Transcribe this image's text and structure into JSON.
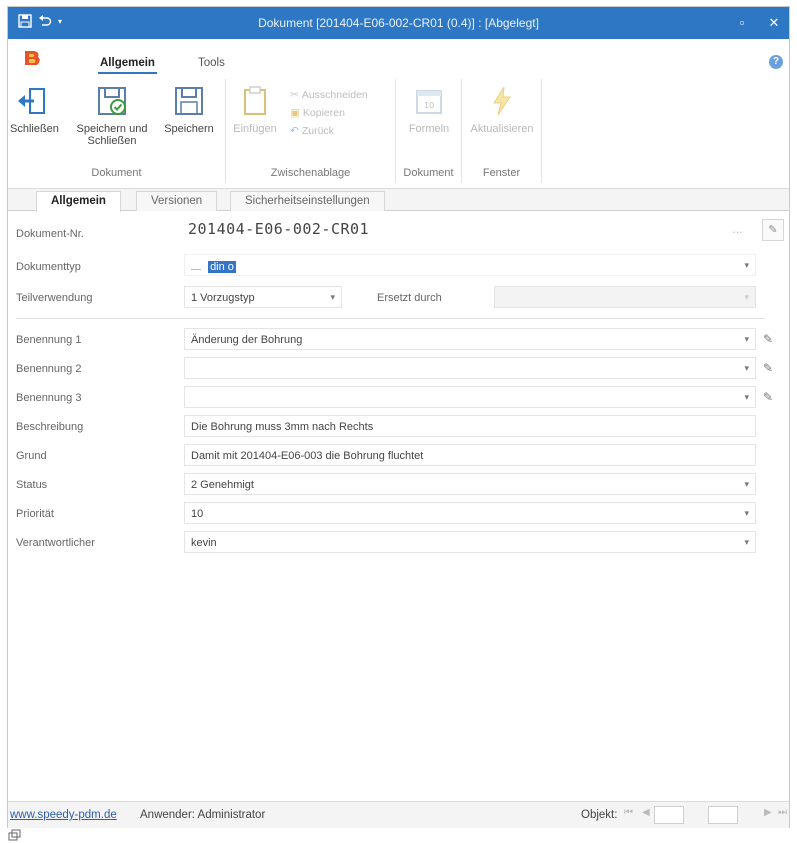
{
  "window": {
    "title": "Dokument [201404-E06-002-CR01 (0.4)] : [Abgelegt]"
  },
  "ribbon": {
    "tabs": [
      "Allgemein",
      "Tools"
    ],
    "groups": {
      "dokument": {
        "label": "Dokument",
        "buttons": [
          "Schließen",
          "Speichern und Schließen",
          "Speichern"
        ]
      },
      "zwischenablage": {
        "label": "Zwischenablage",
        "paste": "Einfügen",
        "cut": "Ausschneiden",
        "copy": "Kopieren",
        "undo": "Zurück"
      },
      "dokument2": {
        "label": "Dokument",
        "formeln": "Formeln"
      },
      "fenster": {
        "label": "Fenster",
        "aktualisieren": "Aktualisieren"
      }
    }
  },
  "doc_tabs": [
    "Allgemein",
    "Versionen",
    "Sicherheitseinstellungen"
  ],
  "form": {
    "dokument_nr": {
      "label": "Dokument-Nr.",
      "value": "201404-E06-002-CR01"
    },
    "dokumenttyp": {
      "label": "Dokumenttyp",
      "value": "din o"
    },
    "teilverwendung": {
      "label": "Teilverwendung",
      "value": "1  Vorzugstyp"
    },
    "ersetzt_durch": {
      "label": "Ersetzt durch",
      "value": ""
    },
    "benennung1": {
      "label": "Benennung 1",
      "value": "Änderung der Bohrung"
    },
    "benennung2": {
      "label": "Benennung 2",
      "value": ""
    },
    "benennung3": {
      "label": "Benennung 3",
      "value": ""
    },
    "beschreibung": {
      "label": "Beschreibung",
      "value": "Die Bohrung muss 3mm nach Rechts"
    },
    "grund": {
      "label": "Grund",
      "value": "Damit mit 201404-E06-003 die Bohrung fluchtet"
    },
    "status": {
      "label": "Status",
      "value": "2  Genehmigt"
    },
    "prioritaet": {
      "label": "Priorität",
      "value": "10"
    },
    "verantwortlicher": {
      "label": "Verantwortlicher",
      "value": "kevin"
    }
  },
  "statusbar": {
    "link": "www.speedy-pdm.de",
    "user": "Anwender: Administrator",
    "objekt": "Objekt:"
  },
  "colors": {
    "titlebar": "#2d77c5",
    "accent": "#2d77c5"
  }
}
